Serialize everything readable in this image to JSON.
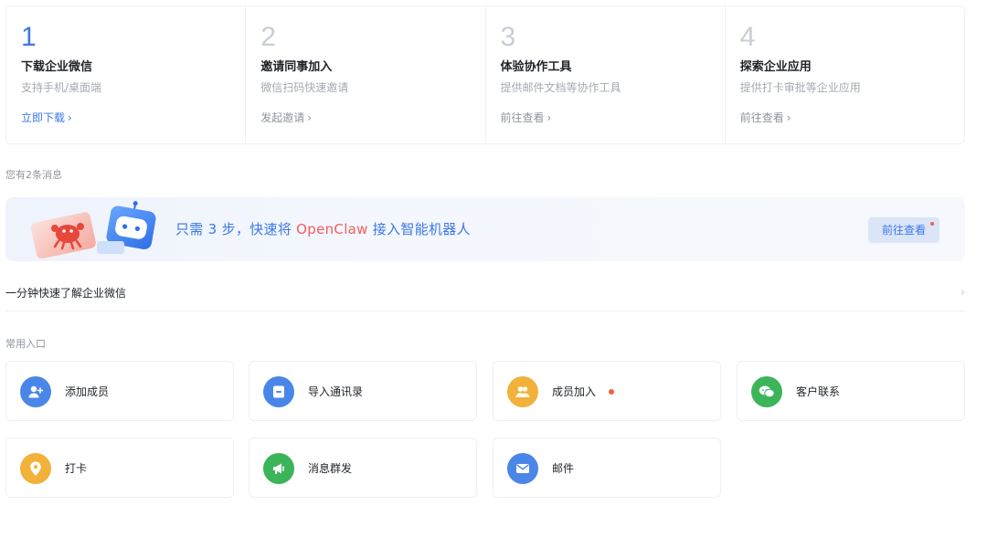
{
  "steps": [
    {
      "num": "1",
      "title": "下载企业微信",
      "desc": "支持手机/桌面端",
      "link": "立即下载",
      "active": true
    },
    {
      "num": "2",
      "title": "邀请同事加入",
      "desc": "微信扫码快速邀请",
      "link": "发起邀请",
      "active": false
    },
    {
      "num": "3",
      "title": "体验协作工具",
      "desc": "提供邮件文档等协作工具",
      "link": "前往查看",
      "active": false
    },
    {
      "num": "4",
      "title": "探索企业应用",
      "desc": "提供打卡审批等企业应用",
      "link": "前往查看",
      "active": false
    }
  ],
  "messages": {
    "count_text": "您有2条消息"
  },
  "banner": {
    "text_before": "只需 3 步，快速将 ",
    "text_highlight": "OpenClaw",
    "text_after": " 接入智能机器人",
    "button": "前往查看"
  },
  "intro": {
    "label": "一分钟快速了解企业微信"
  },
  "entries": {
    "label": "常用入口",
    "items": [
      {
        "label": "添加成员",
        "icon": "add-member-icon",
        "color": "#4a86e8",
        "dot": false
      },
      {
        "label": "导入通讯录",
        "icon": "import-contacts-icon",
        "color": "#4a86e8",
        "dot": false
      },
      {
        "label": "成员加入",
        "icon": "member-join-icon",
        "color": "#f2b13a",
        "dot": true
      },
      {
        "label": "客户联系",
        "icon": "customer-contact-icon",
        "color": "#3cb55a",
        "dot": false
      },
      {
        "label": "打卡",
        "icon": "check-in-icon",
        "color": "#f2b13a",
        "dot": false
      },
      {
        "label": "消息群发",
        "icon": "broadcast-icon",
        "color": "#3cb55a",
        "dot": false
      },
      {
        "label": "邮件",
        "icon": "mail-icon",
        "color": "#4a86e8",
        "dot": false
      }
    ]
  },
  "colors": {
    "accent": "#3b78e7",
    "highlight": "#f25d5d"
  }
}
